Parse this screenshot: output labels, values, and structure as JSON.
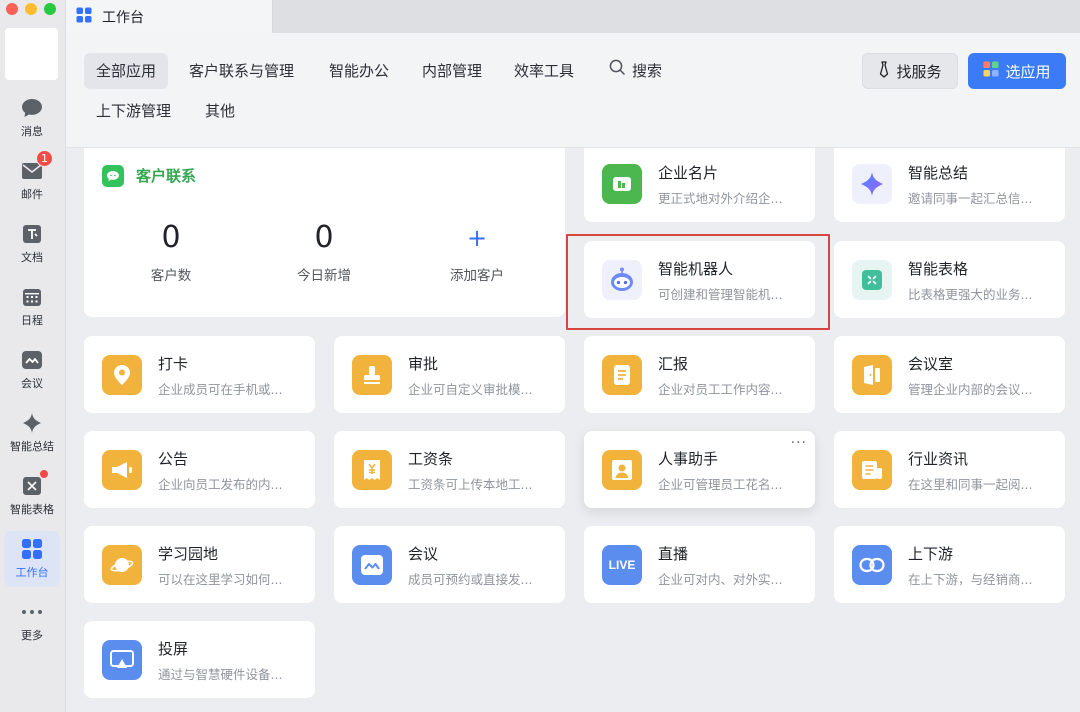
{
  "window": {
    "tab_title": "工作台"
  },
  "sidebar": {
    "items": [
      {
        "label": "消息",
        "icon": "message-icon"
      },
      {
        "label": "邮件",
        "icon": "mail-icon",
        "badge": "1"
      },
      {
        "label": "文档",
        "icon": "doc-icon"
      },
      {
        "label": "日程",
        "icon": "calendar-icon"
      },
      {
        "label": "会议",
        "icon": "meeting-icon"
      },
      {
        "label": "智能总结",
        "icon": "sparkle-icon"
      },
      {
        "label": "智能表格",
        "icon": "smart-table-icon"
      },
      {
        "label": "工作台",
        "icon": "workbench-icon",
        "active": true
      },
      {
        "label": "更多",
        "icon": "more-icon"
      }
    ]
  },
  "header": {
    "categories": [
      {
        "label": "全部应用",
        "active": true
      },
      {
        "label": "客户联系与管理"
      },
      {
        "label": "智能办公"
      },
      {
        "label": "内部管理"
      },
      {
        "label": "效率工具"
      },
      {
        "label": "搜索",
        "icon": "search-icon"
      },
      {
        "label": "上下游管理"
      },
      {
        "label": "其他"
      }
    ],
    "find_service_label": "找服务",
    "pick_app_label": "选应用"
  },
  "customer_contact": {
    "title": "客户联系",
    "stats": [
      {
        "value": "0",
        "label": "客户数"
      },
      {
        "value": "0",
        "label": "今日新增"
      },
      {
        "value": "+",
        "label": "添加客户"
      }
    ]
  },
  "apps": [
    {
      "name": "企业名片",
      "desc": "更正式地对外介绍企...",
      "color": "#4cb64f",
      "icon": "business-card-icon"
    },
    {
      "name": "智能总结",
      "desc": "邀请同事一起汇总信...",
      "color": "#eef0fb",
      "icon": "sparkle-icon"
    },
    {
      "name": "智能机器人",
      "desc": "可创建和管理智能机...",
      "color": "#eef0fb",
      "icon": "robot-icon",
      "highlighted": true
    },
    {
      "name": "智能表格",
      "desc": "比表格更强大的业务...",
      "color": "#e6f5f1",
      "icon": "smart-table-icon"
    },
    {
      "name": "打卡",
      "desc": "企业成员可在手机或...",
      "color": "#f2b33d",
      "icon": "location-pin-icon"
    },
    {
      "name": "审批",
      "desc": "企业可自定义审批模...",
      "color": "#f2b33d",
      "icon": "stamp-icon"
    },
    {
      "name": "汇报",
      "desc": "企业对员工工作内容...",
      "color": "#f2b33d",
      "icon": "report-icon"
    },
    {
      "name": "会议室",
      "desc": "管理企业内部的会议...",
      "color": "#f2b33d",
      "icon": "door-icon"
    },
    {
      "name": "公告",
      "desc": "企业向员工发布的内...",
      "color": "#f2b33d",
      "icon": "megaphone-icon"
    },
    {
      "name": "工资条",
      "desc": "工资条可上传本地工...",
      "color": "#f2b33d",
      "icon": "payslip-icon"
    },
    {
      "name": "人事助手",
      "desc": "企业可管理员工花名...",
      "color": "#f2b33d",
      "icon": "person-icon",
      "more": "···"
    },
    {
      "name": "行业资讯",
      "desc": "在这里和同事一起阅...",
      "color": "#f2b33d",
      "icon": "news-icon"
    },
    {
      "name": "学习园地",
      "desc": "可以在这里学习如何...",
      "color": "#f2b33d",
      "icon": "planet-icon"
    },
    {
      "name": "会议",
      "desc": "成员可预约或直接发...",
      "color": "#5b8def",
      "icon": "meeting-icon"
    },
    {
      "name": "直播",
      "desc": "企业可对内、对外实...",
      "color": "#5b8def",
      "icon": "live-icon",
      "icon_text": "LIVE"
    },
    {
      "name": "上下游",
      "desc": "在上下游，与经销商...",
      "color": "#5b8def",
      "icon": "link-icon"
    },
    {
      "name": "投屏",
      "desc": "通过与智慧硬件设备...",
      "color": "#5b8def",
      "icon": "screen-cast-icon"
    }
  ]
}
